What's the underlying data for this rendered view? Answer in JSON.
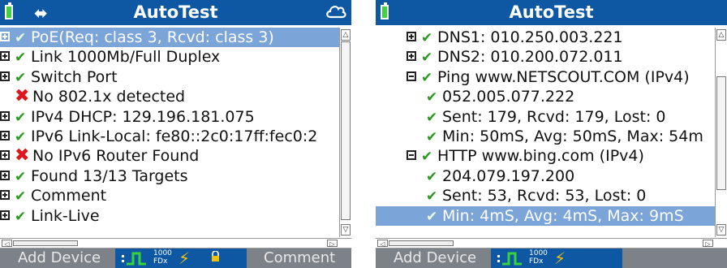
{
  "left": {
    "title": "AutoTest",
    "rows": [
      {
        "label": "PoE(Req: class 3, Rcvd: class 3)",
        "status": "pass"
      },
      {
        "label": "Link 1000Mb/Full Duplex",
        "status": "pass"
      },
      {
        "label": "Switch Port",
        "status": "pass"
      },
      {
        "label": "No 802.1x detected",
        "status": "fail"
      },
      {
        "label": "IPv4 DHCP: 129.196.181.075",
        "status": "pass"
      },
      {
        "label": "IPv6 Link-Local: fe80::2c0:17ff:fec0:2",
        "status": "pass"
      },
      {
        "label": "No IPv6 Router Found",
        "status": "fail"
      },
      {
        "label": "Found 13/13 Targets",
        "status": "pass"
      },
      {
        "label": "Comment",
        "status": "pass"
      },
      {
        "label": "Link-Live",
        "status": "pass"
      }
    ],
    "buttons": {
      "add_device": "Add Device",
      "comment": "Comment"
    },
    "speed_top": "1000",
    "speed_bottom": "FDx"
  },
  "right": {
    "title": "AutoTest",
    "rows": [
      {
        "label": "DNS1: 010.250.003.221"
      },
      {
        "label": "DNS2: 010.200.072.011"
      },
      {
        "label": "Ping www.NETSCOUT.COM (IPv4)"
      },
      {
        "label": "052.005.077.222"
      },
      {
        "label": "Sent: 179, Rcvd: 179, Lost: 0"
      },
      {
        "label": "Min: 50mS, Avg: 50mS, Max: 54m"
      },
      {
        "label": "HTTP www.bing.com (IPv4)"
      },
      {
        "label": "204.079.197.200"
      },
      {
        "label": "Sent: 53, Rcvd: 53, Lost: 0"
      },
      {
        "label": "Min: 4mS, Avg: 4mS, Max: 9mS"
      }
    ],
    "buttons": {
      "add_device": "Add Device"
    },
    "speed_top": "1000",
    "speed_bottom": "FDx"
  },
  "colors": {
    "titlebar": "#0d57a3",
    "selection": "#7ba4d8",
    "check": "#2a9a1f",
    "fail": "#e0141a",
    "bottombar": "#7d8289"
  },
  "icons": {
    "battery": "battery-icon",
    "usb": "usb-icon",
    "cloud": "cloud-icon",
    "pass": "checkmark-icon",
    "fail": "x-icon",
    "lock": "lock-icon",
    "bolt": "lightning-icon"
  }
}
